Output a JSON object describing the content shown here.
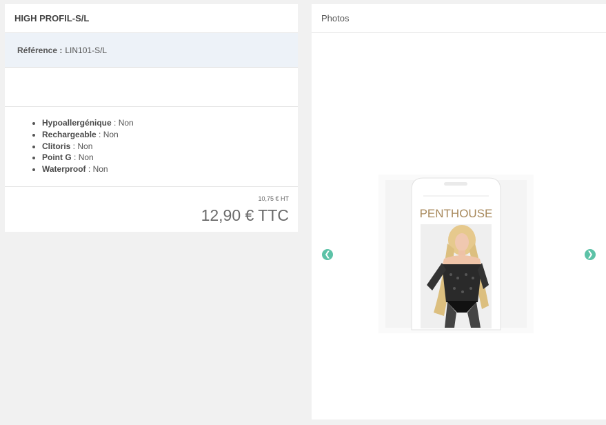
{
  "product": {
    "title": "HIGH PROFIL-S/L",
    "reference_label": "Référence :",
    "reference_value": "LIN101-S/L",
    "features": [
      {
        "name": "Hypoallergénique",
        "sep": " : ",
        "value": "Non"
      },
      {
        "name": "Rechargeable",
        "sep": " : ",
        "value": "Non"
      },
      {
        "name": "Clitoris",
        "sep": " : ",
        "value": "Non"
      },
      {
        "name": "Point G",
        "sep": " : ",
        "value": "Non"
      },
      {
        "name": "Waterproof",
        "sep": " : ",
        "value": "Non"
      }
    ],
    "price_ht": "10,75 € HT",
    "price_ttc": "12,90 € TTC"
  },
  "photos": {
    "title": "Photos",
    "prev_icon": "chevron-left-icon",
    "next_icon": "chevron-right-icon",
    "prev_glyph": "❮",
    "next_glyph": "❯",
    "image_brand_text": "PENTHOUSE",
    "accent_color": "#5cc2a7"
  }
}
